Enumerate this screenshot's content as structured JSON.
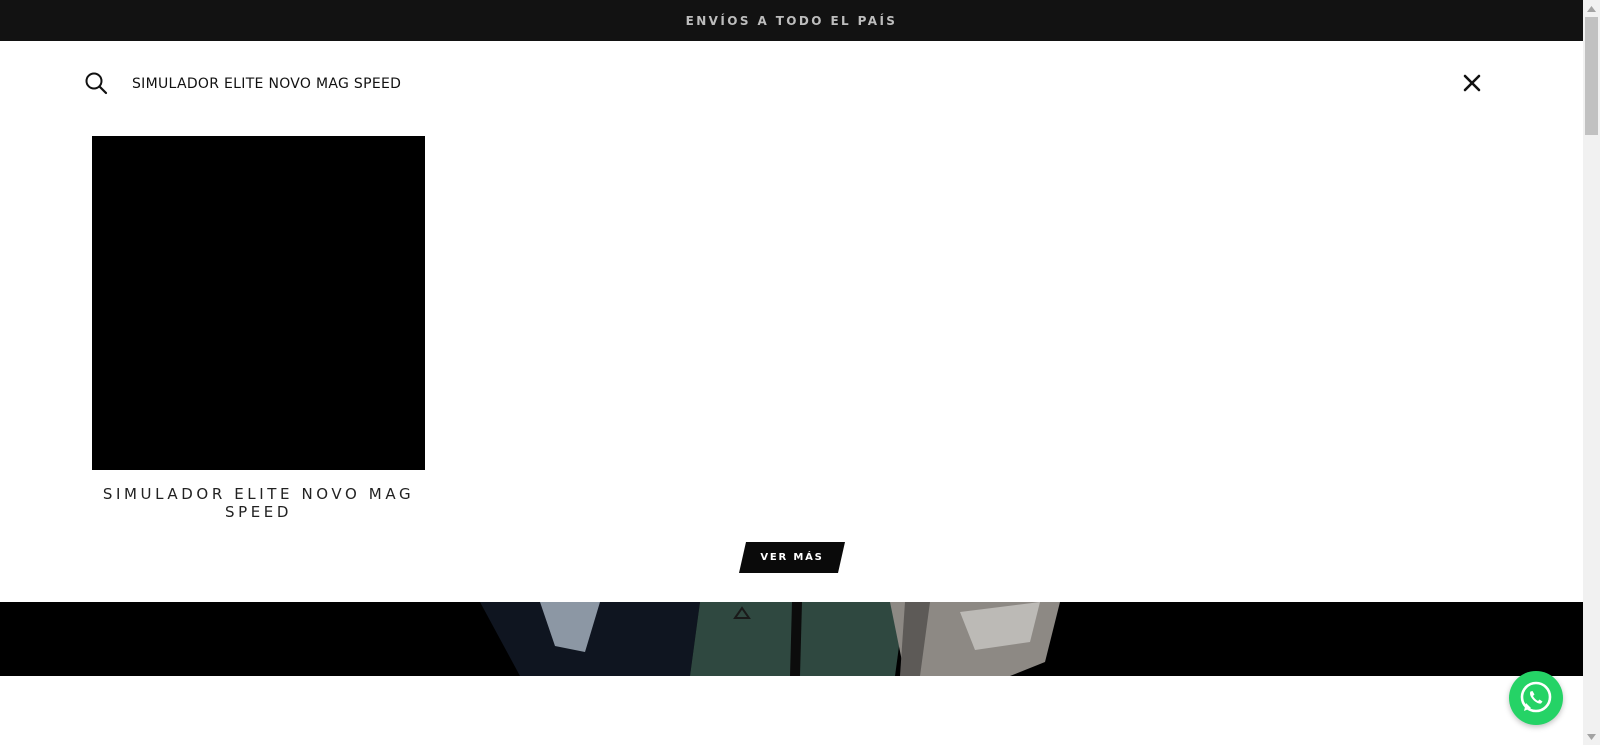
{
  "topbar": {
    "text": "ENVÍOS A TODO EL PAÍS"
  },
  "search": {
    "value": "SIMULADOR ELITE NOVO MAG SPEED"
  },
  "results": [
    {
      "title": "SIMULADOR ELITE NOVO MAG SPEED"
    }
  ],
  "more_button": {
    "label": "VER MÁS"
  },
  "icons": {
    "search": "search-icon",
    "close": "close-icon",
    "whatsapp": "whatsapp-icon",
    "scroll_up": "chevron-up-icon",
    "scroll_down": "chevron-down-icon"
  },
  "colors": {
    "topbar_bg": "#121212",
    "topbar_text": "#bdbdbd",
    "button_bg": "#0a0a0a",
    "whatsapp": "#25d366",
    "hero_bg": "#000000"
  }
}
